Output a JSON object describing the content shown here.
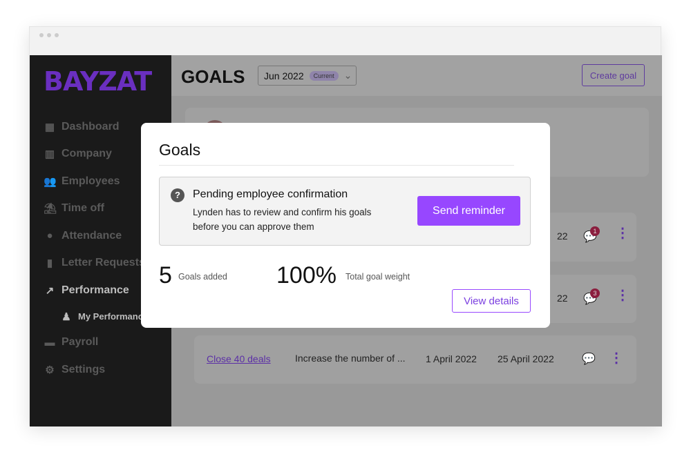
{
  "brand": {
    "logo": "BAYZAT",
    "accent": "#9747ff",
    "logo_color": "#6a2fc0"
  },
  "sidebar": {
    "items": [
      {
        "label": "Dashboard",
        "icon": "dashboard-icon",
        "glyph": "▦"
      },
      {
        "label": "Company",
        "icon": "building-icon",
        "glyph": "▥"
      },
      {
        "label": "Employees",
        "icon": "people-icon",
        "glyph": "👥"
      },
      {
        "label": "Time off",
        "icon": "beach-umbrella-icon",
        "glyph": "⛱"
      },
      {
        "label": "Attendance",
        "icon": "location-pin-icon",
        "glyph": "●"
      },
      {
        "label": "Letter Requests",
        "icon": "document-icon",
        "glyph": "▮"
      },
      {
        "label": "Performance",
        "icon": "trend-up-icon",
        "glyph": "↗"
      },
      {
        "label": "My Performance",
        "icon": "person-chart-icon",
        "glyph": "♟"
      },
      {
        "label": "Payroll",
        "icon": "money-icon",
        "glyph": "▬"
      },
      {
        "label": "Settings",
        "icon": "gear-icon",
        "glyph": "⚙"
      }
    ]
  },
  "header": {
    "title": "GOALS",
    "period": "Jun 2022",
    "period_badge": "Current",
    "create_label": "Create goal"
  },
  "goal_rows": [
    {
      "date_end_partial": "22",
      "comments": "1"
    },
    {
      "date_end_partial": "22",
      "comments": "3"
    },
    {
      "name": "Close 40 deals",
      "description": "Increase the number of ...",
      "start": "1 April 2022",
      "end": "25 April 2022"
    }
  ],
  "modal": {
    "title": "Goals",
    "alert_title": "Pending employee confirmation",
    "alert_text": "Lynden has to review and confirm his goals before you can approve them",
    "send_label": "Send reminder",
    "goals_count": "5",
    "goals_label": "Goals added",
    "weight": "100%",
    "weight_label": "Total goal weight",
    "view_label": "View details"
  }
}
